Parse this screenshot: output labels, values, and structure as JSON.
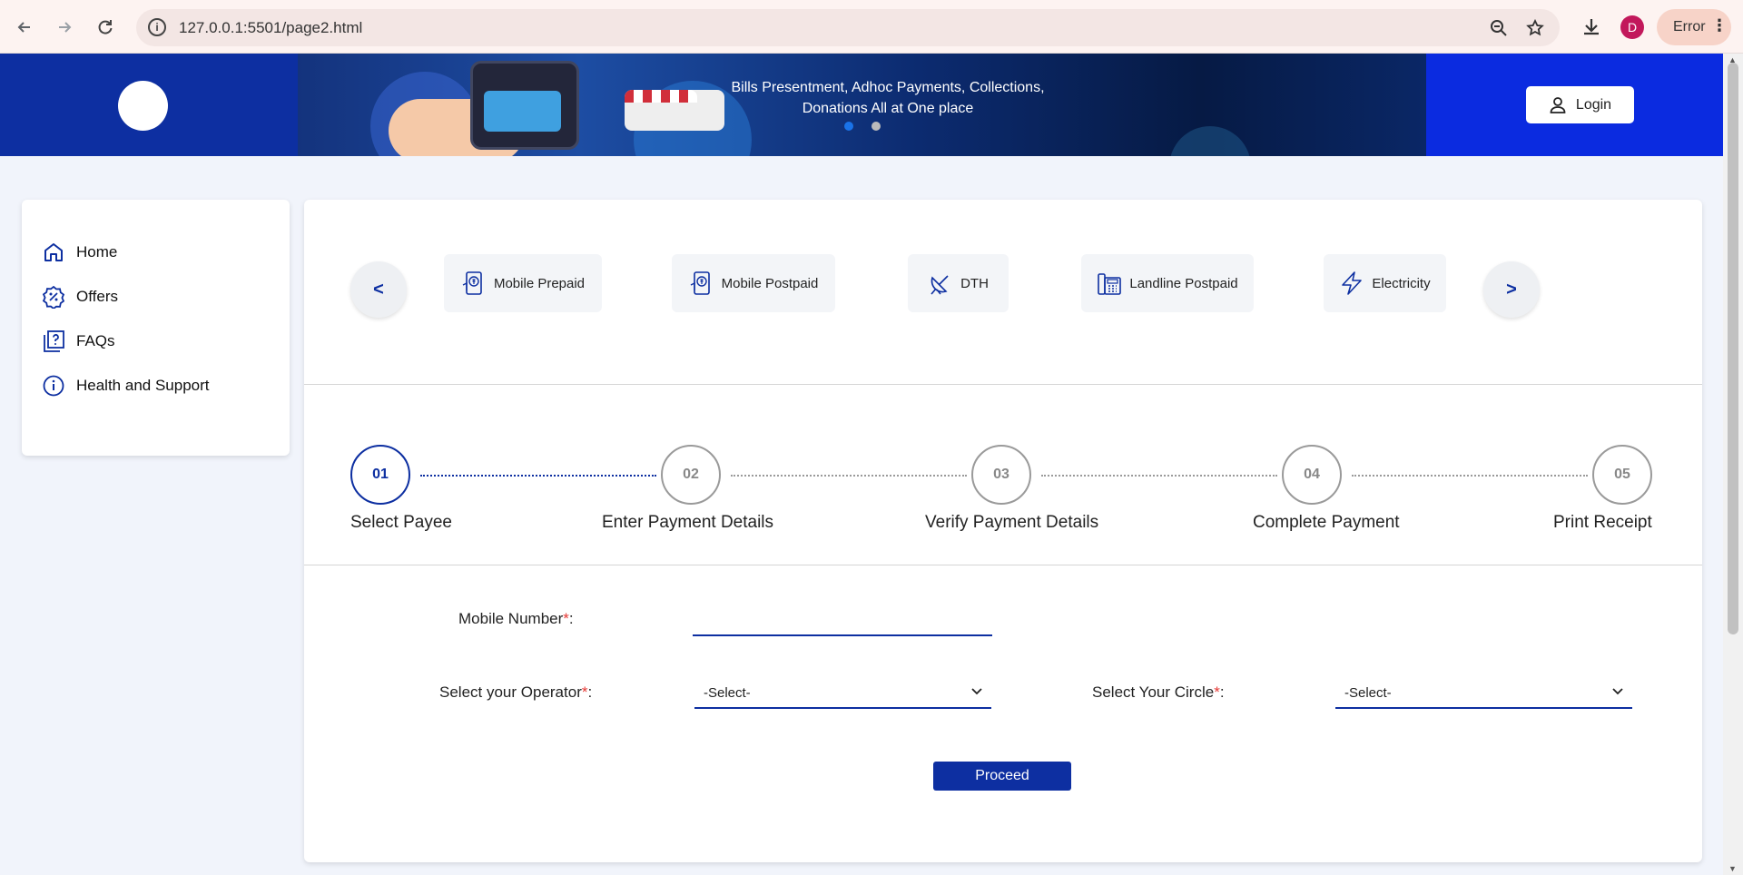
{
  "browser": {
    "url": "127.0.0.1:5501/page2.html",
    "profile_initial": "D",
    "error_label": "Error"
  },
  "header": {
    "banner_caption_line1": "Bills Presentment, Adhoc Payments, Collections,",
    "banner_caption_line2": "Donations All at One place",
    "login_label": "Login"
  },
  "sidebar": {
    "items": [
      {
        "label": "Home",
        "icon": "home-icon"
      },
      {
        "label": "Offers",
        "icon": "offers-icon"
      },
      {
        "label": "FAQs",
        "icon": "faq-icon"
      },
      {
        "label": "Health and Support",
        "icon": "info-icon"
      }
    ]
  },
  "categories": {
    "prev_label": "<",
    "next_label": ">",
    "items": [
      {
        "label": "Mobile Prepaid",
        "icon": "mobile-prepaid-icon"
      },
      {
        "label": "Mobile Postpaid",
        "icon": "mobile-postpaid-icon"
      },
      {
        "label": "DTH",
        "icon": "satellite-dish-icon"
      },
      {
        "label": "Landline Postpaid",
        "icon": "landline-icon"
      },
      {
        "label": "Electricity",
        "icon": "lightning-icon"
      }
    ]
  },
  "steps": [
    {
      "number": "01",
      "label": "Select Payee",
      "active": true
    },
    {
      "number": "02",
      "label": "Enter Payment Details",
      "active": false
    },
    {
      "number": "03",
      "label": "Verify Payment Details",
      "active": false
    },
    {
      "number": "04",
      "label": "Complete Payment",
      "active": false
    },
    {
      "number": "05",
      "label": "Print Receipt",
      "active": false
    }
  ],
  "form": {
    "mobile_label": "Mobile Number",
    "mobile_value": "",
    "operator_label": "Select your Operator",
    "operator_value": "-Select-",
    "circle_label": "Select Your Circle",
    "circle_value": "-Select-",
    "required_mark": "*",
    "colon": ":",
    "proceed_label": "Proceed"
  },
  "colors": {
    "primary": "#0d2fa1",
    "required": "#e53935",
    "profile": "#c2185b"
  }
}
